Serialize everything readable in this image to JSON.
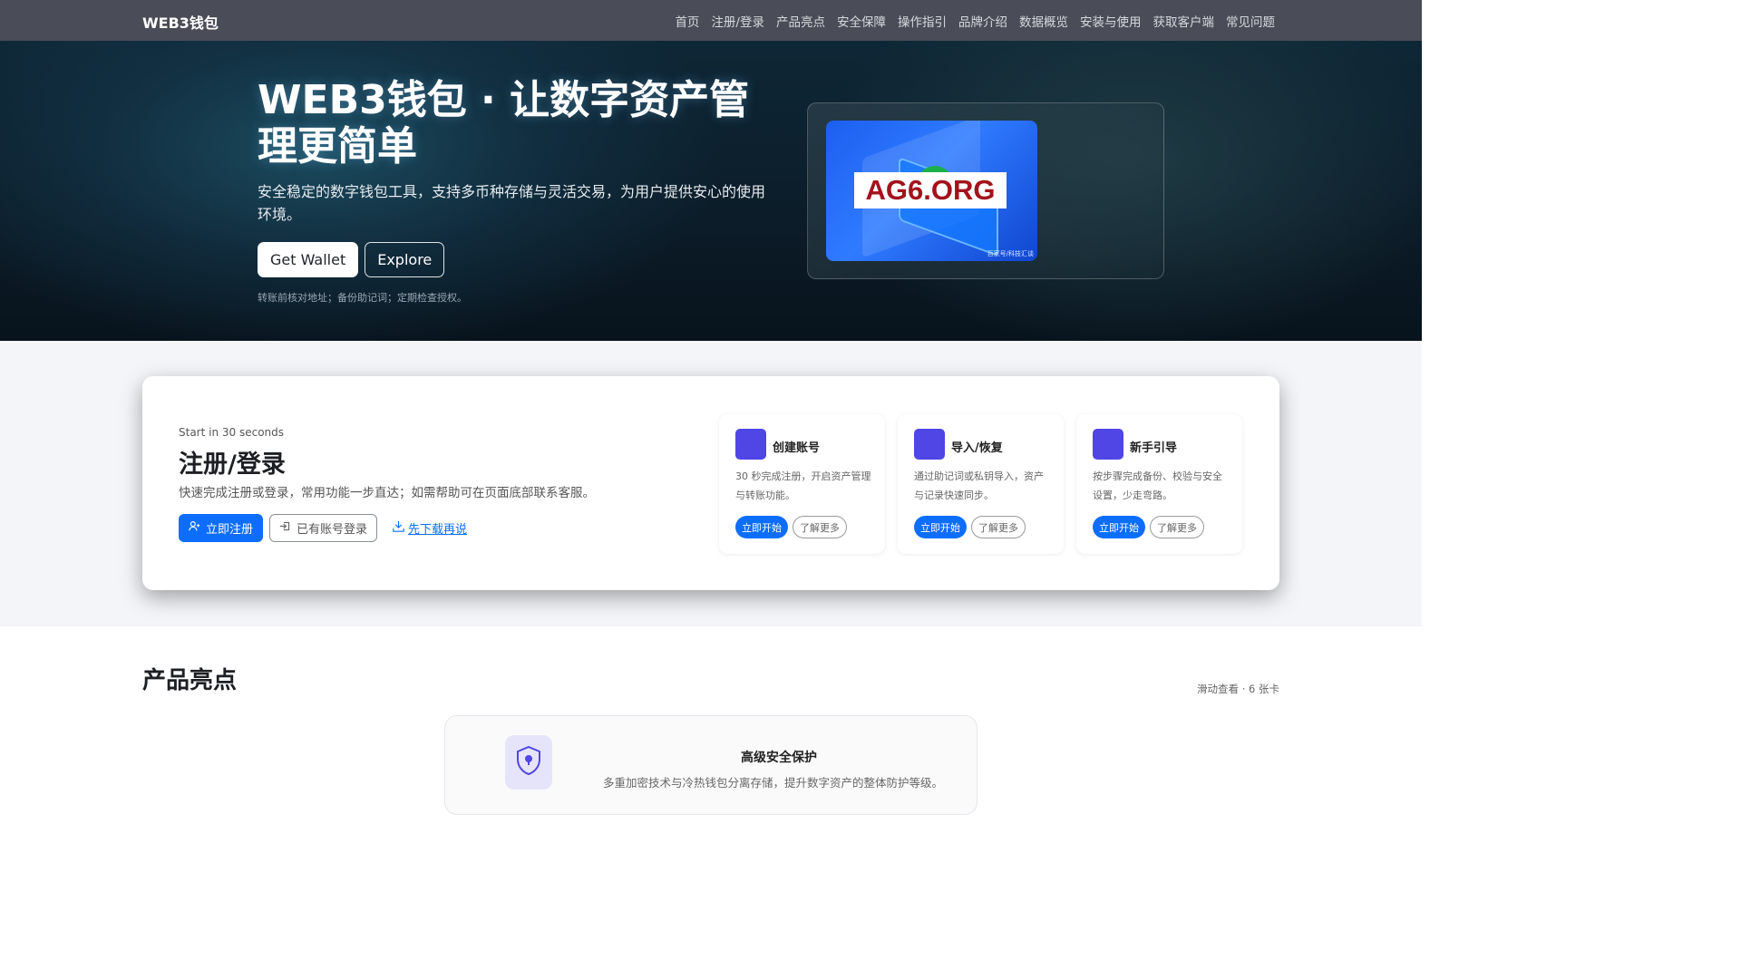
{
  "nav": {
    "brand": "WEB3钱包",
    "links": [
      "首页",
      "注册/登录",
      "产品亮点",
      "安全保障",
      "操作指引",
      "品牌介绍",
      "数据概览",
      "安装与使用",
      "获取客户端",
      "常见问题"
    ]
  },
  "hero": {
    "title": "WEB3钱包 · 让数字资产管理更简单",
    "description": "安全稳定的数字钱包工具，支持多币种存储与灵活交易，为用户提供安心的使用环境。",
    "primary_button": "Get Wallet",
    "secondary_button": "Explore",
    "note": "转账前核对地址；备份助记词；定期检查授权。",
    "image_logo_text": "AG6.ORG",
    "image_caption": "百家号/科技汇谈"
  },
  "start": {
    "kicker": "Start in 30 seconds",
    "title": "注册/登录",
    "description": "快速完成注册或登录，常用功能一步直达；如需帮助可在页面底部联系客服。",
    "register_button": "立即注册",
    "login_button": "已有账号登录",
    "download_link": "先下载再说",
    "cards": [
      {
        "title": "创建账号",
        "description": "30 秒完成注册，开启资产管理与转账功能。",
        "primary": "立即开始",
        "secondary": "了解更多"
      },
      {
        "title": "导入/恢复",
        "description": "通过助记词或私钥导入，资产与记录快速同步。",
        "primary": "立即开始",
        "secondary": "了解更多"
      },
      {
        "title": "新手引导",
        "description": "按步骤完成备份、校验与安全设置，少走弯路。",
        "primary": "立即开始",
        "secondary": "了解更多"
      }
    ]
  },
  "highlights": {
    "title": "产品亮点",
    "hint": "滑动查看 · 6 张卡",
    "card": {
      "title": "高级安全保护",
      "description": "多重加密技术与冷热钱包分离存储，提升数字资产的整体防护等级。",
      "icon": "shield-icon"
    }
  },
  "colors": {
    "primary": "#0d6efd",
    "accent_icon": "#4f46e5",
    "navbar": "#4a4d57",
    "logo_red": "#a3131c"
  }
}
